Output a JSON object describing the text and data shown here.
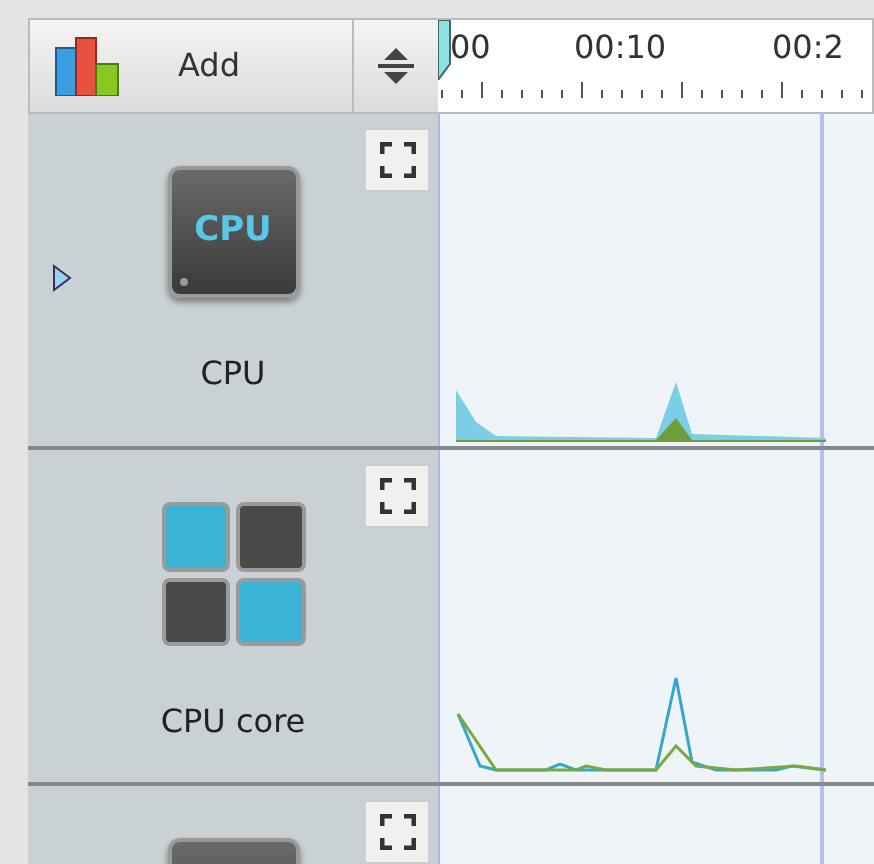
{
  "toolbar": {
    "add_button": "Add"
  },
  "timeline": {
    "labels": [
      "00",
      "00:10",
      "00:2"
    ]
  },
  "rows": [
    {
      "kind": "cpu",
      "label": "CPU",
      "icon_text": "CPU",
      "expandable": true
    },
    {
      "kind": "cores",
      "label": "CPU core",
      "expandable": false
    },
    {
      "kind": "stub",
      "expandable": false
    }
  ]
}
